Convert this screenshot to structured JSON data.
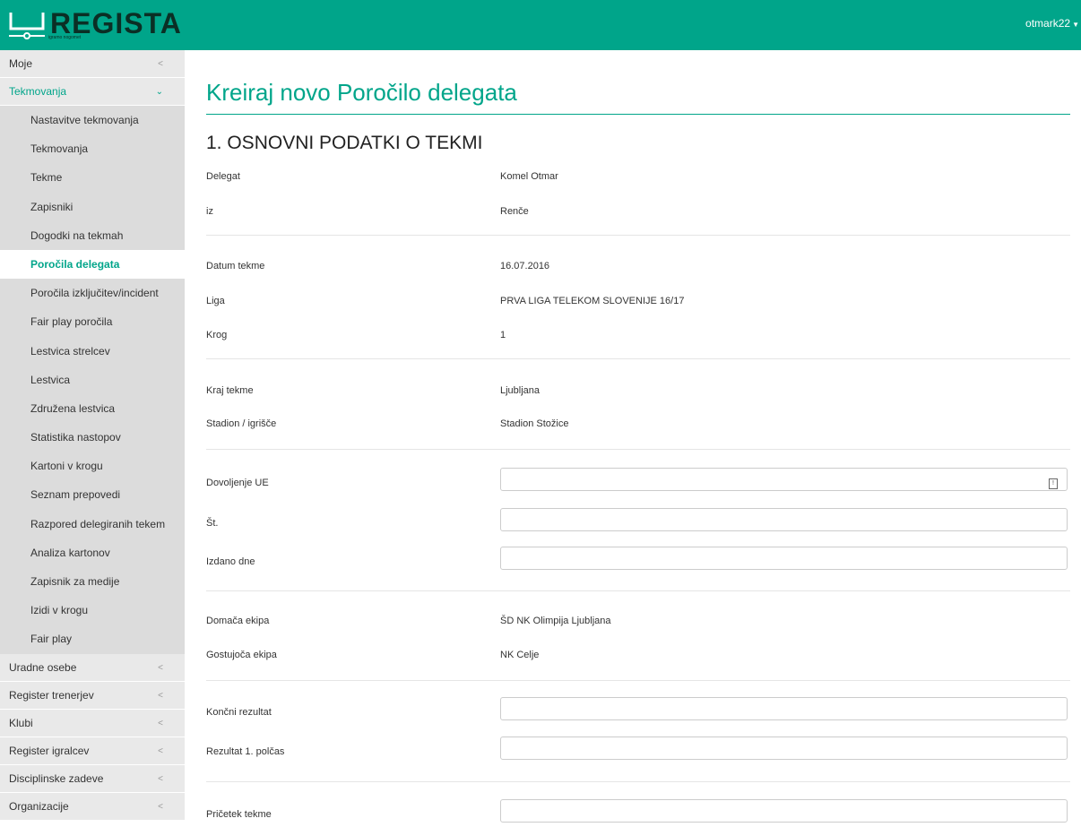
{
  "header": {
    "logo_text": "REGISTA",
    "logo_sub": "igramo nogomet",
    "user": "otmark22"
  },
  "sidebar": {
    "items_top": [
      {
        "label": "Moje",
        "open": false
      },
      {
        "label": "Tekmovanja",
        "open": true
      }
    ],
    "sub_items": [
      {
        "label": "Nastavitve tekmovanja",
        "active": false
      },
      {
        "label": "Tekmovanja",
        "active": false
      },
      {
        "label": "Tekme",
        "active": false
      },
      {
        "label": "Zapisniki",
        "active": false
      },
      {
        "label": "Dogodki na tekmah",
        "active": false
      },
      {
        "label": "Poročila delegata",
        "active": true
      },
      {
        "label": "Poročila izključitev/incident",
        "active": false
      },
      {
        "label": "Fair play poročila",
        "active": false
      },
      {
        "label": "Lestvica strelcev",
        "active": false
      },
      {
        "label": "Lestvica",
        "active": false
      },
      {
        "label": "Združena lestvica",
        "active": false
      },
      {
        "label": "Statistika nastopov",
        "active": false
      },
      {
        "label": "Kartoni v krogu",
        "active": false
      },
      {
        "label": "Seznam prepovedi",
        "active": false
      },
      {
        "label": "Razpored delegiranih tekem",
        "active": false
      },
      {
        "label": "Analiza kartonov",
        "active": false
      },
      {
        "label": "Zapisnik za medije",
        "active": false
      },
      {
        "label": "Izidi v krogu",
        "active": false
      },
      {
        "label": "Fair play",
        "active": false
      }
    ],
    "items_bottom": [
      {
        "label": "Uradne osebe"
      },
      {
        "label": "Register trenerjev"
      },
      {
        "label": "Klubi"
      },
      {
        "label": "Register igralcev"
      },
      {
        "label": "Disciplinske zadeve"
      },
      {
        "label": "Organizacije"
      }
    ]
  },
  "main": {
    "title": "Kreiraj novo Poročilo delegata",
    "section": "1. OSNOVNI PODATKI O TEKMI",
    "fields": {
      "delegat": {
        "label": "Delegat",
        "value": "Komel Otmar"
      },
      "iz": {
        "label": "iz",
        "value": "Renče"
      },
      "datum": {
        "label": "Datum tekme",
        "value": "16.07.2016"
      },
      "liga": {
        "label": "Liga",
        "value": "PRVA LIGA TELEKOM SLOVENIJE 16/17"
      },
      "krog": {
        "label": "Krog",
        "value": "1"
      },
      "kraj": {
        "label": "Kraj tekme",
        "value": "Ljubljana"
      },
      "stadion": {
        "label": "Stadion / igrišče",
        "value": "Stadion Stožice"
      },
      "dovoljenje": {
        "label": "Dovoljenje UE",
        "value": ""
      },
      "st": {
        "label": "Št.",
        "value": ""
      },
      "izdano": {
        "label": "Izdano dne",
        "value": ""
      },
      "domaca": {
        "label": "Domača ekipa",
        "value": "ŠD NK Olimpija Ljubljana"
      },
      "gostujoca": {
        "label": "Gostujoča ekipa",
        "value": "NK Celje"
      },
      "koncni": {
        "label": "Končni rezultat",
        "value": ""
      },
      "polcas": {
        "label": "Rezultat 1. polčas",
        "value": ""
      },
      "pricetek": {
        "label": "Pričetek tekme",
        "value": ""
      }
    }
  },
  "colors": {
    "accent": "#00a58a",
    "sidebar_bg": "#e4e4e4"
  }
}
